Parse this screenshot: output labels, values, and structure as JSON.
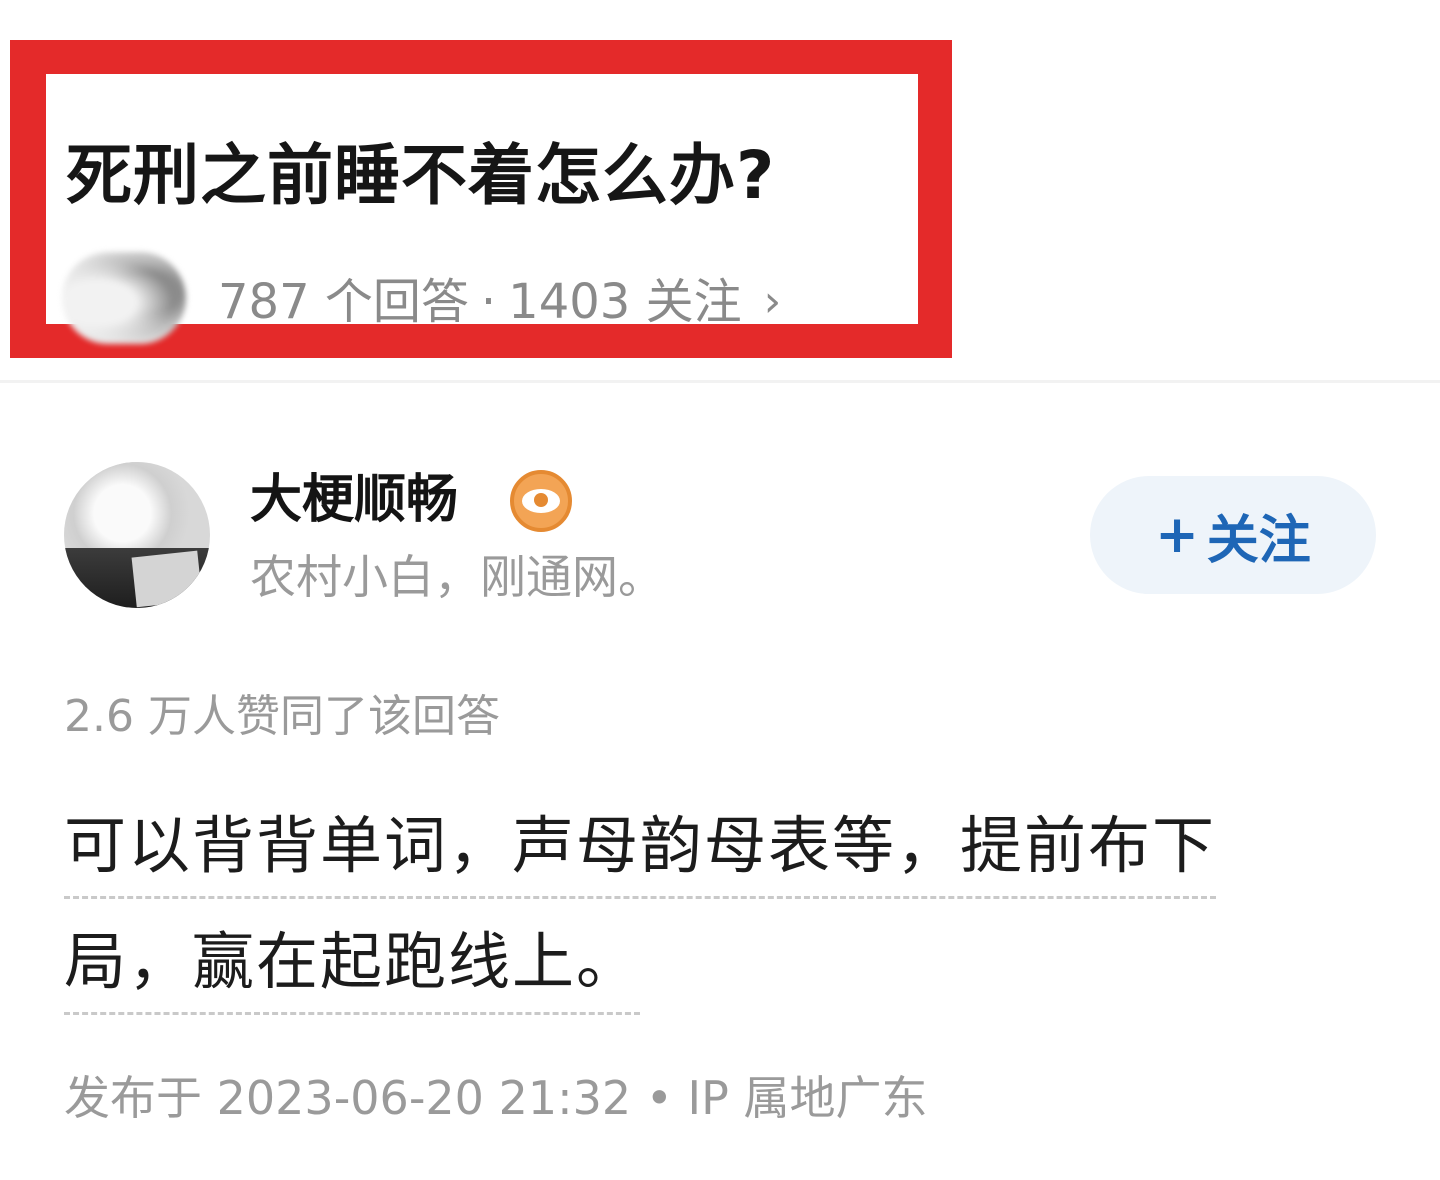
{
  "question": {
    "title": "死刑之前睡不着怎么办?",
    "answer_count": "787 个回答",
    "separator": "·",
    "follower_count": "1403 关注",
    "chevron": "›"
  },
  "author": {
    "name": "大梗顺畅",
    "badge_icon": "eye-badge-icon",
    "bio": "农村小白，刚通网。",
    "follow_plus": "+",
    "follow_label": "关注"
  },
  "answer": {
    "vote_text": "2.6 万人赞同了该回答",
    "lines": [
      "可以背背单词，声母韵母表等，提前布下",
      "局，赢在起跑线上。"
    ],
    "publish_info": "发布于 2023-06-20 21:32 • IP 属地广东"
  },
  "colors": {
    "highlight_frame": "#e42a2a",
    "follow_text": "#1e66b6",
    "follow_bg": "#eef4fa",
    "badge": "#f3a455",
    "muted_text": "#9a9a9a"
  }
}
